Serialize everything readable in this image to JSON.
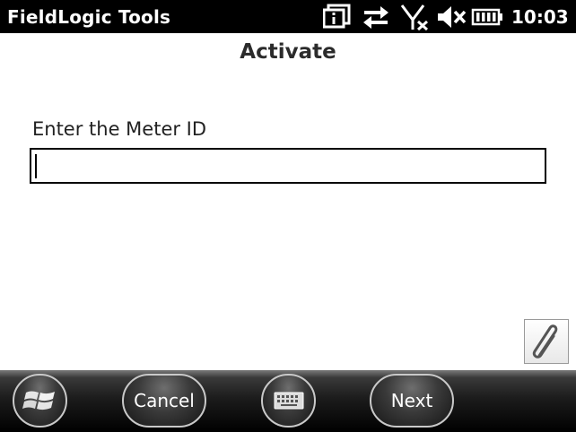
{
  "status_bar": {
    "app_title": "FieldLogic Tools",
    "time": "10:03",
    "icons": [
      "notification-icon",
      "data-sync-icon",
      "no-signal-icon",
      "speaker-muted-icon",
      "battery-icon"
    ]
  },
  "main": {
    "title": "Activate",
    "meter_id_label": "Enter the Meter ID",
    "meter_id_value": "",
    "attach_icon": "paperclip-icon"
  },
  "softkeys": {
    "start_icon": "windows-start-icon",
    "cancel_label": "Cancel",
    "keyboard_icon": "keyboard-icon",
    "next_label": "Next"
  }
}
